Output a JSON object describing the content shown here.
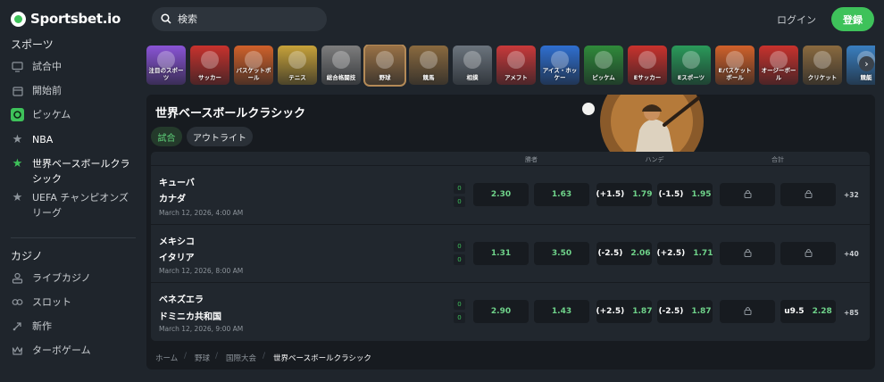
{
  "brand": {
    "name": "Sportsbet.io",
    "accent": "#3ec25a"
  },
  "sidebar": {
    "sports_title": "スポーツ",
    "sports_items": [
      {
        "label": "試合中",
        "icon": "monitor-icon"
      },
      {
        "label": "開始前",
        "icon": "calendar-icon"
      },
      {
        "label": "ピッケム",
        "icon": "pickem-icon"
      },
      {
        "label": "NBA",
        "icon": "star-icon"
      },
      {
        "label": "世界ベースボールクラシック",
        "icon": "star-icon"
      },
      {
        "label": "UEFA チャンピオンズリーグ",
        "icon": "star-icon"
      }
    ],
    "casino_title": "カジノ",
    "casino_items": [
      {
        "label": "ライブカジノ",
        "icon": "live-casino-icon"
      },
      {
        "label": "スロット",
        "icon": "slots-icon"
      },
      {
        "label": "新作",
        "icon": "rocket-icon"
      },
      {
        "label": "ターボゲーム",
        "icon": "crown-icon"
      }
    ]
  },
  "header": {
    "search_placeholder": "検索",
    "login": "ログイン",
    "register": "登録"
  },
  "sport_tiles": [
    {
      "label": "注目のスポーツ",
      "color": "#8a54d6"
    },
    {
      "label": "サッカー",
      "color": "#c8322d"
    },
    {
      "label": "バスケットボール",
      "color": "#d0612a"
    },
    {
      "label": "テニス",
      "color": "#c7a23a"
    },
    {
      "label": "総合格闘技",
      "color": "#7d7d7d"
    },
    {
      "label": "野球",
      "color": "#9a7246"
    },
    {
      "label": "競馬",
      "color": "#8a6a3f"
    },
    {
      "label": "相撲",
      "color": "#6b747d"
    },
    {
      "label": "アメフト",
      "color": "#c8393a"
    },
    {
      "label": "アイス・ホッケー",
      "color": "#2f6fd0"
    },
    {
      "label": "ピッケム",
      "color": "#2f8a3a"
    },
    {
      "label": "Eサッカー",
      "color": "#c8322d"
    },
    {
      "label": "Eスポーツ",
      "color": "#2a9a5a"
    },
    {
      "label": "Eバスケットボール",
      "color": "#d0612a"
    },
    {
      "label": "オージーボール",
      "color": "#c8322d"
    },
    {
      "label": "クリケット",
      "color": "#8a6a3f"
    },
    {
      "label": "競艇",
      "color": "#3a7fc0"
    }
  ],
  "competition": {
    "title": "世界ベースボールクラシック",
    "tabs": [
      "試合",
      "アウトライト"
    ],
    "columns": [
      "勝者",
      "ハンデ",
      "合計"
    ],
    "matches": [
      {
        "home": "キューバ",
        "away": "カナダ",
        "date": "March 12, 2026, 4:00 AM",
        "score_home": "0",
        "score_away": "0",
        "win1": "2.30",
        "win2": "1.63",
        "h1_line": "(+1.5)",
        "h1_odd": "1.79",
        "h2_line": "(-1.5)",
        "h2_odd": "1.95",
        "more": "+32"
      },
      {
        "home": "メキシコ",
        "away": "イタリア",
        "date": "March 12, 2026, 8:00 AM",
        "score_home": "0",
        "score_away": "0",
        "win1": "1.31",
        "win2": "3.50",
        "h1_line": "(-2.5)",
        "h1_odd": "2.06",
        "h2_line": "(+2.5)",
        "h2_odd": "1.71",
        "more": "+40"
      },
      {
        "home": "ベネズエラ",
        "away": "ドミニカ共和国",
        "date": "March 12, 2026, 9:00 AM",
        "score_home": "0",
        "score_away": "0",
        "win1": "2.90",
        "win2": "1.43",
        "h1_line": "(+2.5)",
        "h1_odd": "1.87",
        "h2_line": "(-2.5)",
        "h2_odd": "1.87",
        "t2_line": "u9.5",
        "t2_odd": "2.28",
        "more": "+85"
      }
    ]
  },
  "breadcrumb": [
    "ホーム",
    "野球",
    "国際大会",
    "世界ベースボールクラシック"
  ]
}
